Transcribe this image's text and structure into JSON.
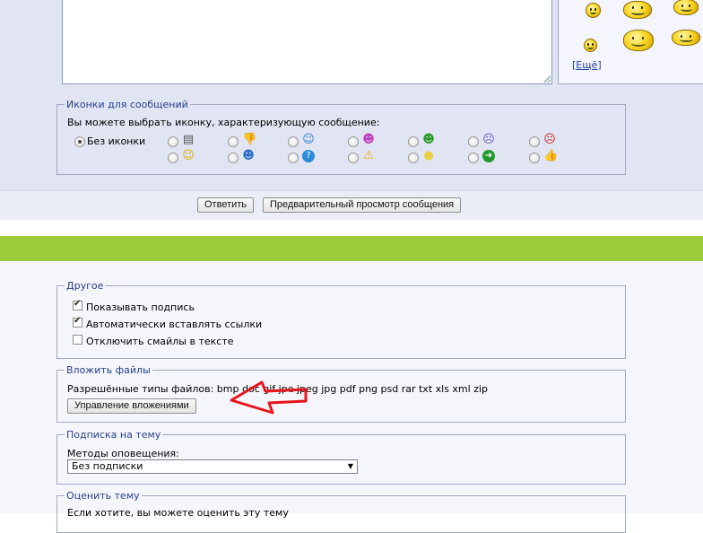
{
  "smilies": {
    "more_link": "Ещё"
  },
  "post_icons": {
    "legend": "Иконки для сообщений",
    "hint": "Вы можете выбрать иконку, характеризующую сообщение:",
    "no_icon_label": "Без иконки",
    "icons_row1": [
      "document-icon",
      "thumb-down-icon",
      "smile-blue-icon",
      "pink-face-icon",
      "grin-icon",
      "sad-face-icon",
      "angry-face-icon"
    ],
    "icons_row2": [
      "smile-icon",
      "cool-face-icon",
      "question-icon",
      "warning-icon",
      "lightbulb-icon",
      "arrow-right-icon",
      "thumb-up-icon"
    ]
  },
  "actions": {
    "reply_label": "Ответить",
    "preview_label": "Предварительный просмотр сообщения"
  },
  "other": {
    "legend": "Другое",
    "show_signature": "Показывать подпись",
    "show_signature_checked": true,
    "auto_links": "Автоматически вставлять ссылки",
    "auto_links_checked": true,
    "disable_smilies": "Отключить смайлы в тексте",
    "disable_smilies_checked": false
  },
  "attachments": {
    "legend": "Вложить файлы",
    "allowed_types": "Разрешённые типы файлов: bmp doc gif jpe jpeg jpg pdf png psd rar txt xls xml zip",
    "manage_label": "Управление вложениями",
    "annotation_color": "#e8141b"
  },
  "subscription": {
    "legend": "Подписка на тему",
    "methods_label": "Методы оповещения:",
    "selected": "Без подписки"
  },
  "rating": {
    "legend": "Оценить тему",
    "hint": "Если хотите, вы можете оценить эту тему"
  },
  "colors": {
    "accent_green": "#9ccb3c",
    "legend_blue": "#26418a"
  }
}
